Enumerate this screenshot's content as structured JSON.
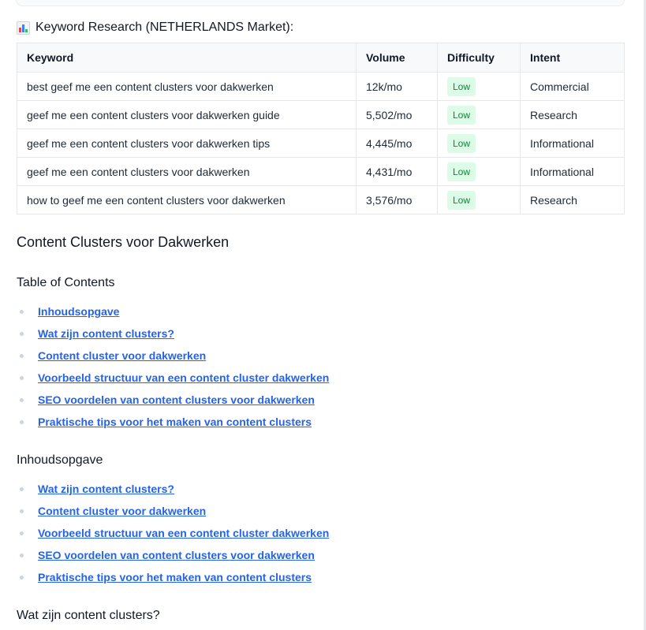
{
  "keyword_research": {
    "icon": "bar-chart-icon",
    "title": "Keyword Research (NETHERLANDS Market):",
    "columns": [
      "Keyword",
      "Volume",
      "Difficulty",
      "Intent"
    ],
    "rows": [
      {
        "keyword": "best geef me een content clusters voor dakwerken",
        "volume": "12k/mo",
        "difficulty": "Low",
        "intent": "Commercial"
      },
      {
        "keyword": "geef me een content clusters voor dakwerken guide",
        "volume": "5,502/mo",
        "difficulty": "Low",
        "intent": "Research"
      },
      {
        "keyword": "geef me een content clusters voor dakwerken tips",
        "volume": "4,445/mo",
        "difficulty": "Low",
        "intent": "Informational"
      },
      {
        "keyword": "geef me een content clusters voor dakwerken",
        "volume": "4,431/mo",
        "difficulty": "Low",
        "intent": "Informational"
      },
      {
        "keyword": "how to geef me een content clusters voor dakwerken",
        "volume": "3,576/mo",
        "difficulty": "Low",
        "intent": "Research"
      }
    ]
  },
  "article": {
    "title": "Content Clusters voor Dakwerken",
    "toc_heading": "Table of Contents",
    "toc_items": [
      "Inhoudsopgave",
      "Wat zijn content clusters?",
      "Content cluster voor dakwerken",
      "Voorbeeld structuur van een content cluster dakwerken",
      "SEO voordelen van content clusters voor dakwerken",
      "Praktische tips voor het maken van content clusters"
    ],
    "inhoud_heading": "Inhoudsopgave",
    "inhoud_items": [
      "Wat zijn content clusters?",
      "Content cluster voor dakwerken",
      "Voorbeeld structuur van een content cluster dakwerken",
      "SEO voordelen van content clusters voor dakwerken",
      "Praktische tips voor het maken van content clusters"
    ],
    "next_heading": "Wat zijn content clusters?"
  },
  "colors": {
    "link": "#2563eb",
    "badge_bg": "#dcfce7",
    "badge_text": "#15803d",
    "border": "#e5e7eb"
  }
}
